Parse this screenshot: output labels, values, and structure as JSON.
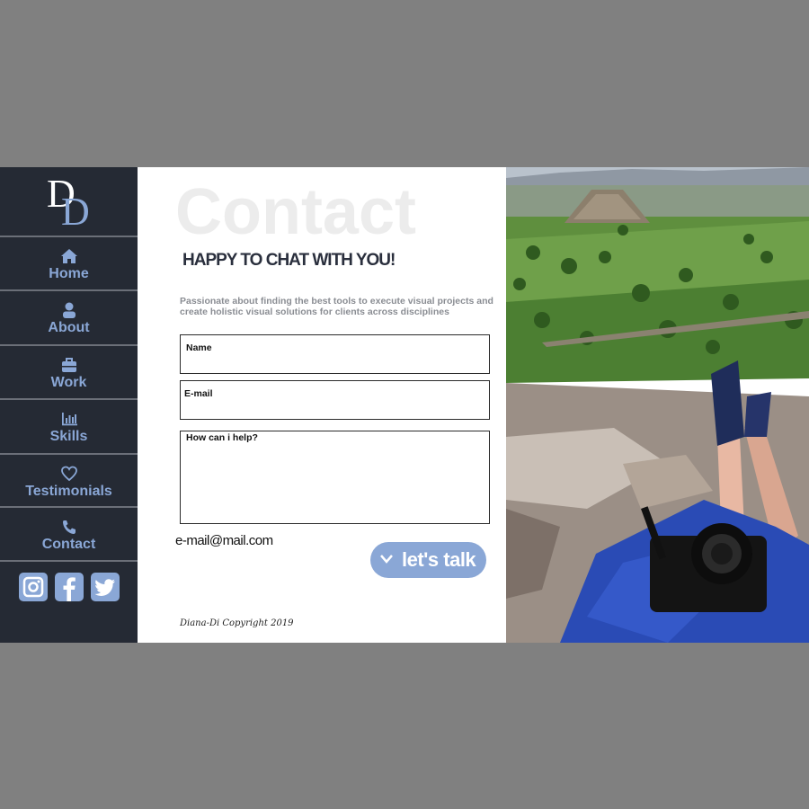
{
  "logo": {
    "letters": "DD"
  },
  "nav": {
    "items": [
      {
        "label": "Home",
        "icon": "home-icon"
      },
      {
        "label": "About",
        "icon": "user-icon"
      },
      {
        "label": "Work",
        "icon": "briefcase-icon"
      },
      {
        "label": "Skills",
        "icon": "bar-chart-icon"
      },
      {
        "label": "Testimonials",
        "icon": "heart-icon"
      },
      {
        "label": "Contact",
        "icon": "phone-icon"
      }
    ]
  },
  "social": [
    "instagram-icon",
    "facebook-icon",
    "twitter-icon"
  ],
  "main": {
    "bg_title": "Contact",
    "headline": "HAPPY TO CHAT WITH YOU!",
    "intro": "Passionate about finding the best tools to execute visual projects and create holistic visual solutions for clients across disciplines",
    "form": {
      "name_label": "Name",
      "email_label": "E-mail",
      "message_label": "How can i help?"
    },
    "email": "e-mail@mail.com",
    "cta_label": "let's talk",
    "copyright": "Diana-Di  Copyright 2019"
  },
  "colors": {
    "sidebar": "#252a34",
    "accent": "#8aa7d6",
    "headline": "#2a2f3d",
    "page_bg": "#808080"
  }
}
